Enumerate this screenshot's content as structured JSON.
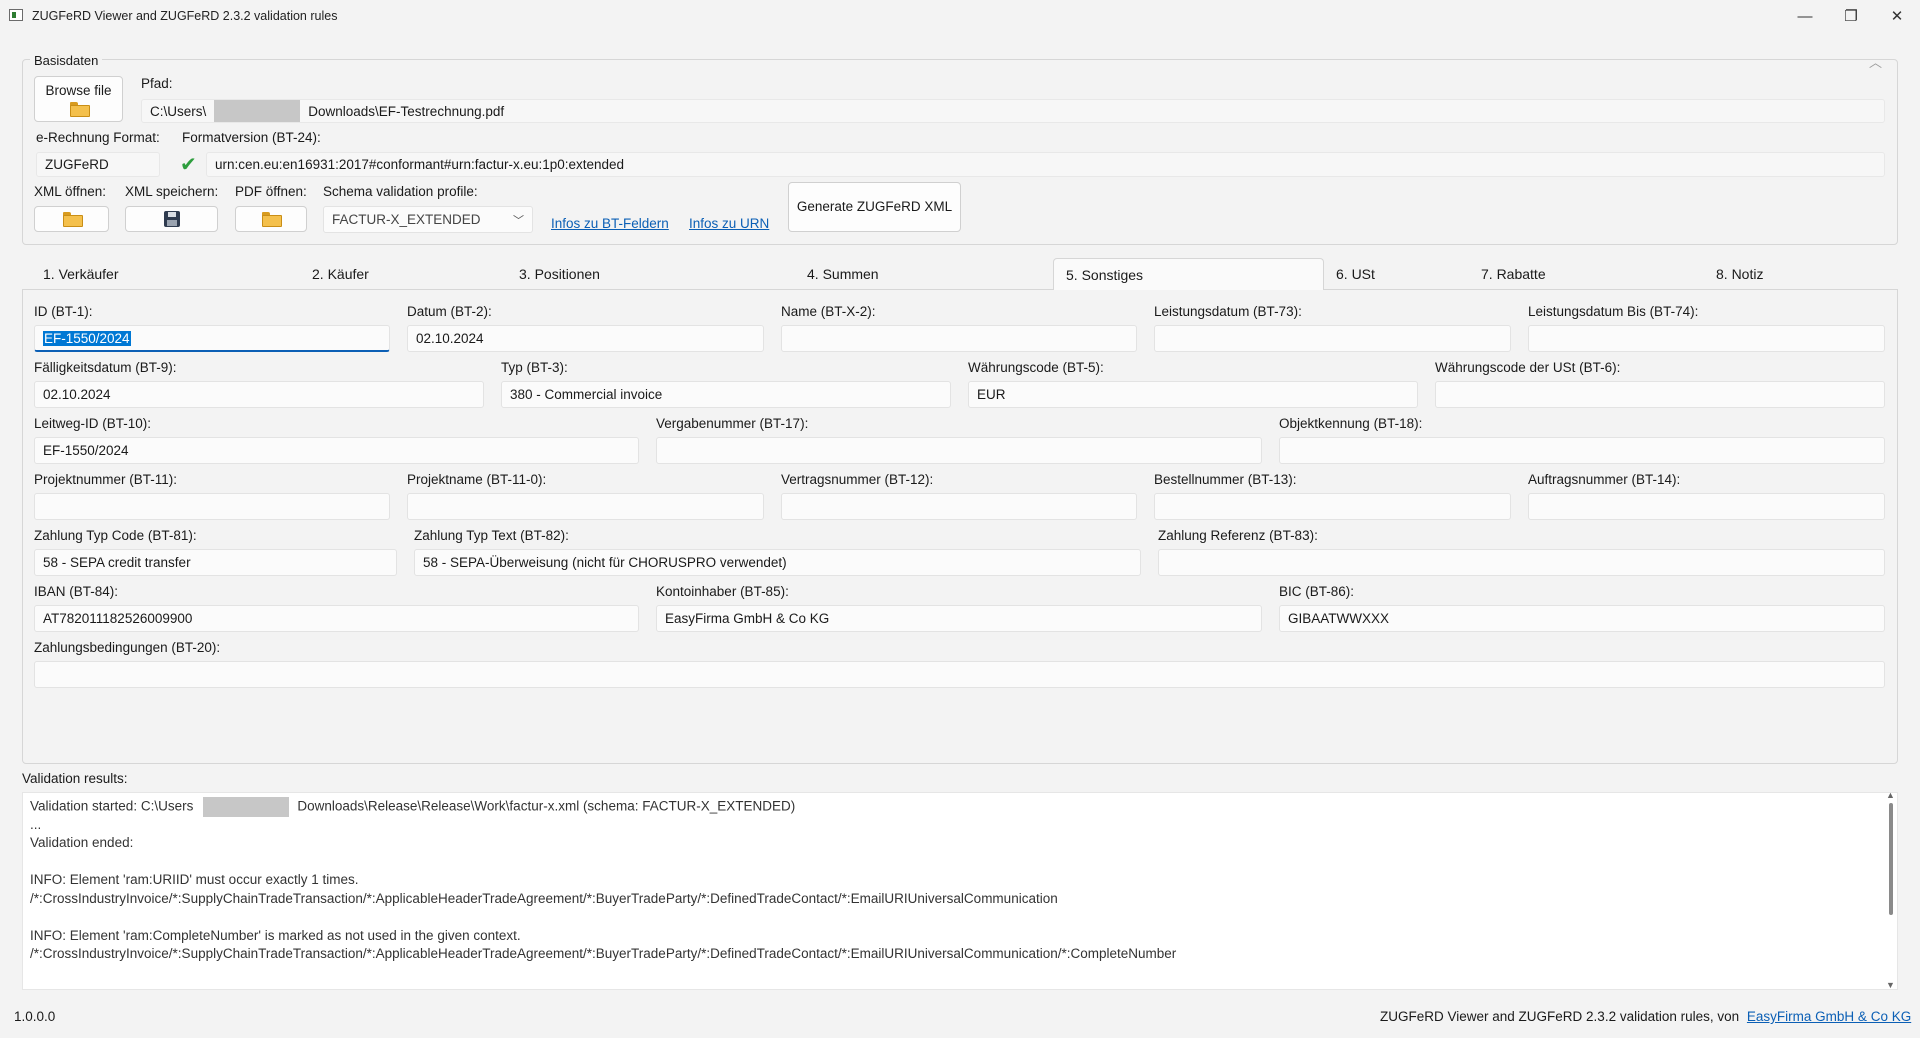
{
  "window": {
    "title": "ZUGFeRD Viewer and ZUGFeRD 2.3.2 validation rules",
    "minimize": "—",
    "restore": "❐",
    "close": "✕"
  },
  "basis": {
    "legend": "Basisdaten",
    "browse_label": "Browse file",
    "pfad_label": "Pfad:",
    "pfad_prefix": "C:\\Users\\",
    "pfad_suffix": "Downloads\\EF-Testrechnung.pdf",
    "format_label": "e-Rechnung Format:",
    "format_value": "ZUGFeRD",
    "formatversion_label": "Formatversion (BT-24):",
    "formatversion_value": "urn:cen.eu:en16931:2017#conformant#urn:factur-x.eu:1p0:extended",
    "xml_open_label": "XML öffnen:",
    "xml_save_label": "XML speichern:",
    "pdf_open_label": "PDF öffnen:",
    "schema_label": "Schema validation profile:",
    "schema_value": "FACTUR-X_EXTENDED",
    "link_bt": "Infos zu BT-Feldern",
    "link_urn": "Infos zu URN",
    "generate_label": "Generate ZUGFeRD XML"
  },
  "tabs": [
    {
      "label": "1. Verkäufer"
    },
    {
      "label": "2. Käufer"
    },
    {
      "label": "3. Positionen"
    },
    {
      "label": "4. Summen"
    },
    {
      "label": "5. Sonstiges"
    },
    {
      "label": "6. USt"
    },
    {
      "label": "7. Rabatte"
    },
    {
      "label": "8. Notiz"
    }
  ],
  "fields": {
    "id": {
      "label": "ID (BT-1):",
      "value": "EF-1550/2024"
    },
    "datum": {
      "label": "Datum (BT-2):",
      "value": "02.10.2024"
    },
    "name": {
      "label": "Name (BT-X-2):",
      "value": ""
    },
    "leistungsdatum": {
      "label": "Leistungsdatum (BT-73):",
      "value": ""
    },
    "leistungsdatum_bis": {
      "label": "Leistungsdatum Bis (BT-74):",
      "value": ""
    },
    "faelligkeit": {
      "label": "Fälligkeitsdatum (BT-9):",
      "value": "02.10.2024"
    },
    "typ": {
      "label": "Typ (BT-3):",
      "value": "380 - Commercial invoice"
    },
    "waehrung": {
      "label": "Währungscode (BT-5):",
      "value": "EUR"
    },
    "waehrung_ust": {
      "label": "Währungscode der USt (BT-6):",
      "value": ""
    },
    "leitweg": {
      "label": "Leitweg-ID (BT-10):",
      "value": "EF-1550/2024"
    },
    "vergabe": {
      "label": "Vergabenummer (BT-17):",
      "value": ""
    },
    "objekt": {
      "label": "Objektkennung (BT-18):",
      "value": ""
    },
    "projektnummer": {
      "label": "Projektnummer (BT-11):",
      "value": ""
    },
    "projektname": {
      "label": "Projektname (BT-11-0):",
      "value": ""
    },
    "vertrag": {
      "label": "Vertragsnummer (BT-12):",
      "value": ""
    },
    "bestell": {
      "label": "Bestellnummer (BT-13):",
      "value": ""
    },
    "auftrag": {
      "label": "Auftragsnummer (BT-14):",
      "value": ""
    },
    "zahlung_code": {
      "label": "Zahlung Typ Code (BT-81):",
      "value": "58 - SEPA credit transfer"
    },
    "zahlung_text": {
      "label": "Zahlung Typ Text (BT-82):",
      "value": "58 - SEPA-Überweisung (nicht für CHORUSPRO verwendet)"
    },
    "zahlung_ref": {
      "label": "Zahlung Referenz (BT-83):",
      "value": ""
    },
    "iban": {
      "label": "IBAN (BT-84):",
      "value": "AT782011182526009900"
    },
    "kontoinhaber": {
      "label": "Kontoinhaber (BT-85):",
      "value": "EasyFirma GmbH & Co KG"
    },
    "bic": {
      "label": "BIC (BT-86):",
      "value": "GIBAATWWXXX"
    },
    "zahlungsbedingungen": {
      "label": "Zahlungsbedingungen (BT-20):",
      "value": ""
    }
  },
  "validation": {
    "label": "Validation results:",
    "started_prefix": "Validation started: C:\\Users",
    "started_suffix": "Downloads\\Release\\Release\\Work\\factur-x.xml (schema: FACTUR-X_EXTENDED)",
    "lines": [
      "...",
      "Validation ended:",
      "",
      "INFO: Element 'ram:URIID' must occur exactly 1 times.",
      "/*:CrossIndustryInvoice/*:SupplyChainTradeTransaction/*:ApplicableHeaderTradeAgreement/*:BuyerTradeParty/*:DefinedTradeContact/*:EmailURIUniversalCommunication",
      "",
      "INFO: Element 'ram:CompleteNumber' is marked as not used in the given context.",
      "/*:CrossIndustryInvoice/*:SupplyChainTradeTransaction/*:ApplicableHeaderTradeAgreement/*:BuyerTradeParty/*:DefinedTradeContact/*:EmailURIUniversalCommunication/*:CompleteNumber"
    ]
  },
  "footer": {
    "version": "1.0.0.0",
    "text": "ZUGFeRD Viewer and ZUGFeRD 2.3.2 validation rules, von",
    "link": "EasyFirma GmbH & Co KG"
  }
}
